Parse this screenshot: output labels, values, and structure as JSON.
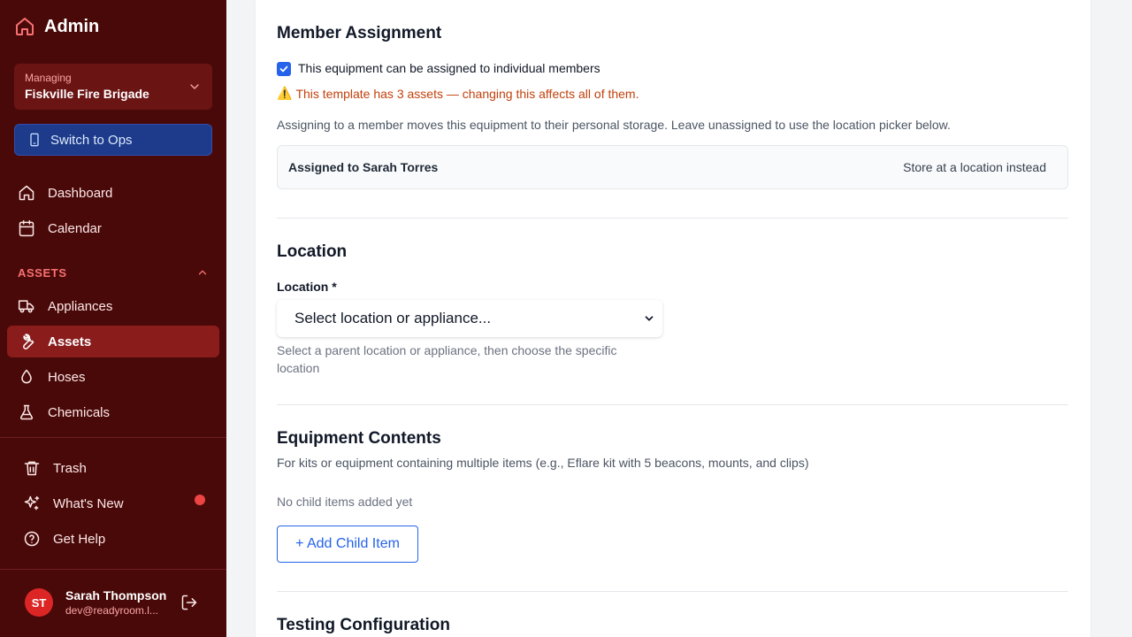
{
  "sidebar": {
    "brand": "Admin",
    "org": {
      "label": "Managing",
      "name": "Fiskville Fire Brigade"
    },
    "switch_label": "Switch to Ops",
    "nav": [
      {
        "label": "Dashboard",
        "icon": "home-icon"
      },
      {
        "label": "Calendar",
        "icon": "calendar-icon"
      }
    ],
    "section": "ASSETS",
    "assets": [
      {
        "label": "Appliances",
        "icon": "truck-icon"
      },
      {
        "label": "Assets",
        "icon": "wrench-icon",
        "active": true
      },
      {
        "label": "Hoses",
        "icon": "droplet-icon"
      },
      {
        "label": "Chemicals",
        "icon": "flask-icon"
      }
    ],
    "bottom": [
      {
        "label": "Trash",
        "icon": "trash-icon"
      },
      {
        "label": "What's New",
        "icon": "sparkles-icon"
      },
      {
        "label": "Get Help",
        "icon": "help-circle-icon"
      }
    ],
    "user": {
      "initials": "ST",
      "name": "Sarah Thompson",
      "email": "dev@readyroom.l..."
    }
  },
  "member": {
    "title": "Member Assignment",
    "checkbox_label": "This equipment can be assigned to individual members",
    "checkbox_checked": true,
    "warning_emoji": "⚠️",
    "warning": "This template has 3 assets — changing this affects all of them.",
    "help": "Assigning to a member moves this equipment to their personal storage. Leave unassigned to use the location picker below.",
    "assigned": "Assigned to Sarah Torres",
    "alt_link": "Store at a location instead"
  },
  "location": {
    "title": "Location",
    "label": "Location *",
    "select_value": "Select location or appliance...",
    "hint": "Select a parent location or appliance, then choose the specific location"
  },
  "contents": {
    "title": "Equipment Contents",
    "subtitle": "For kits or equipment containing multiple items (e.g., Eflare kit with 5 beacons, mounts, and clips)",
    "empty": "No child items added yet",
    "add_label": "+ Add Child Item"
  },
  "testing": {
    "title": "Testing Configuration"
  },
  "colors": {
    "sidebar_bg": "#4a0909",
    "active_bg": "#8a1c1c",
    "accent_blue": "#2563eb",
    "warning": "#c2410c"
  }
}
